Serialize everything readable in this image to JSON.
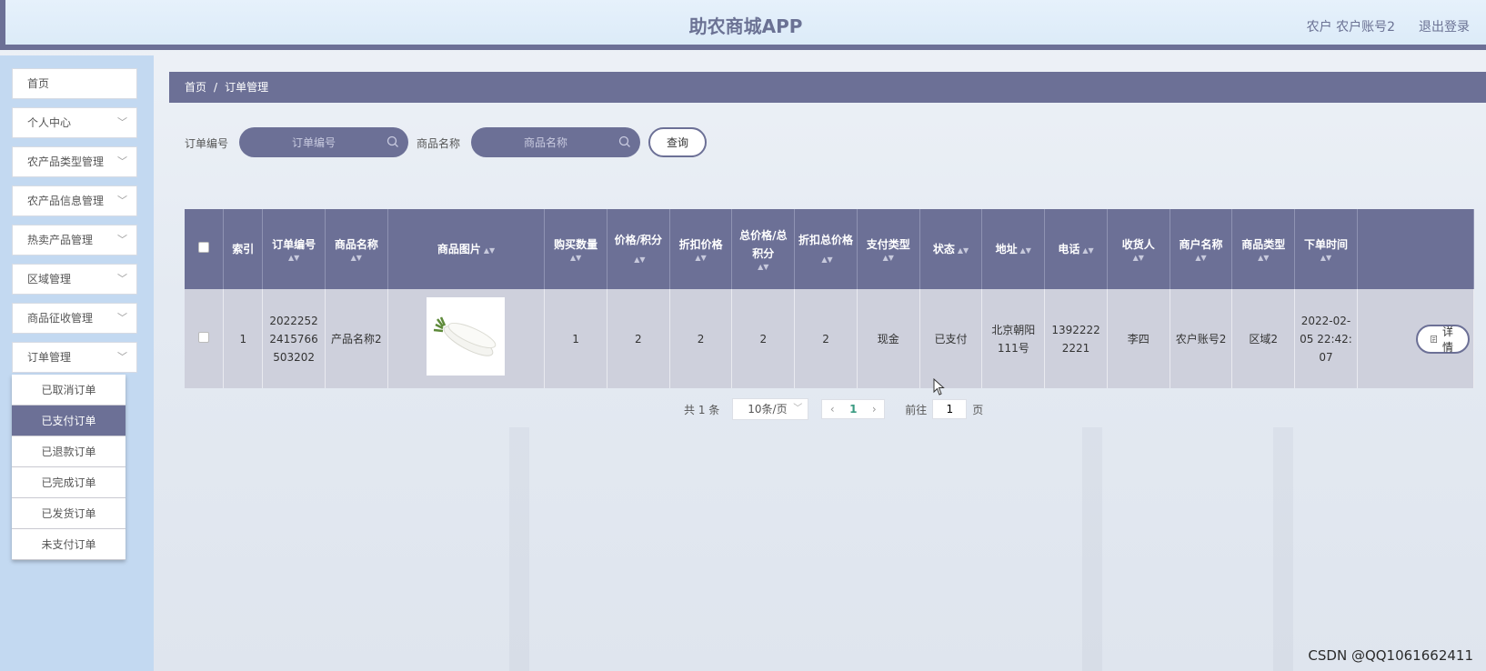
{
  "header": {
    "title": "助农商城APP",
    "user": "农户 农户账号2",
    "logout": "退出登录"
  },
  "sidebar": {
    "items": [
      {
        "label": "首页",
        "has_children": false
      },
      {
        "label": "个人中心",
        "has_children": true
      },
      {
        "label": "农产品类型管理",
        "has_children": true
      },
      {
        "label": "农产品信息管理",
        "has_children": true
      },
      {
        "label": "热卖产品管理",
        "has_children": true
      },
      {
        "label": "区域管理",
        "has_children": true
      },
      {
        "label": "商品征收管理",
        "has_children": true
      },
      {
        "label": "订单管理",
        "has_children": true
      }
    ],
    "submenu": [
      {
        "label": "已取消订单",
        "active": false
      },
      {
        "label": "已支付订单",
        "active": true
      },
      {
        "label": "已退款订单",
        "active": false
      },
      {
        "label": "已完成订单",
        "active": false
      },
      {
        "label": "已发货订单",
        "active": false
      },
      {
        "label": "未支付订单",
        "active": false
      }
    ]
  },
  "breadcrumb": {
    "home": "首页",
    "separator": "/",
    "current": "订单管理"
  },
  "search": {
    "order_no_label": "订单编号",
    "order_no_placeholder": "订单编号",
    "product_name_label": "商品名称",
    "product_name_placeholder": "商品名称",
    "query_button": "查询"
  },
  "table": {
    "headers": {
      "index": "索引",
      "order_no": "订单编号",
      "product_name": "商品名称",
      "product_image": "商品图片",
      "quantity": "购买数量",
      "price_points": "价格/积分",
      "discount_price": "折扣价格",
      "total_price_points": "总价格/总积分",
      "discount_total": "折扣总价格",
      "pay_type": "支付类型",
      "status": "状态",
      "address": "地址",
      "phone": "电话",
      "receiver": "收货人",
      "merchant": "商户名称",
      "product_type": "商品类型",
      "order_time": "下单时间"
    },
    "rows": [
      {
        "index": "1",
        "order_no": "20222522415766503202",
        "product_name": "产品名称2",
        "quantity": "1",
        "price_points": "2",
        "discount_price": "2",
        "total_price_points": "2",
        "discount_total": "2",
        "pay_type": "现金",
        "status": "已支付",
        "address": "北京朝阳111号",
        "phone": "13922222221",
        "receiver": "李四",
        "merchant": "农户账号2",
        "product_type": "区域2",
        "order_time": "2022-02-05 22:42:07",
        "detail_button": "详情"
      }
    ]
  },
  "pagination": {
    "total": "共 1 条",
    "page_size": "10条/页",
    "current_page": "1",
    "goto_label": "前往",
    "goto_value": "1",
    "page_unit": "页"
  },
  "watermark": "CSDN @QQ1061662411",
  "colors": {
    "primary": "#6c7096",
    "sidebar_bg": "#c3d9f1",
    "header_bg": "#dcebf8",
    "row_bg": "#ced0dc"
  }
}
